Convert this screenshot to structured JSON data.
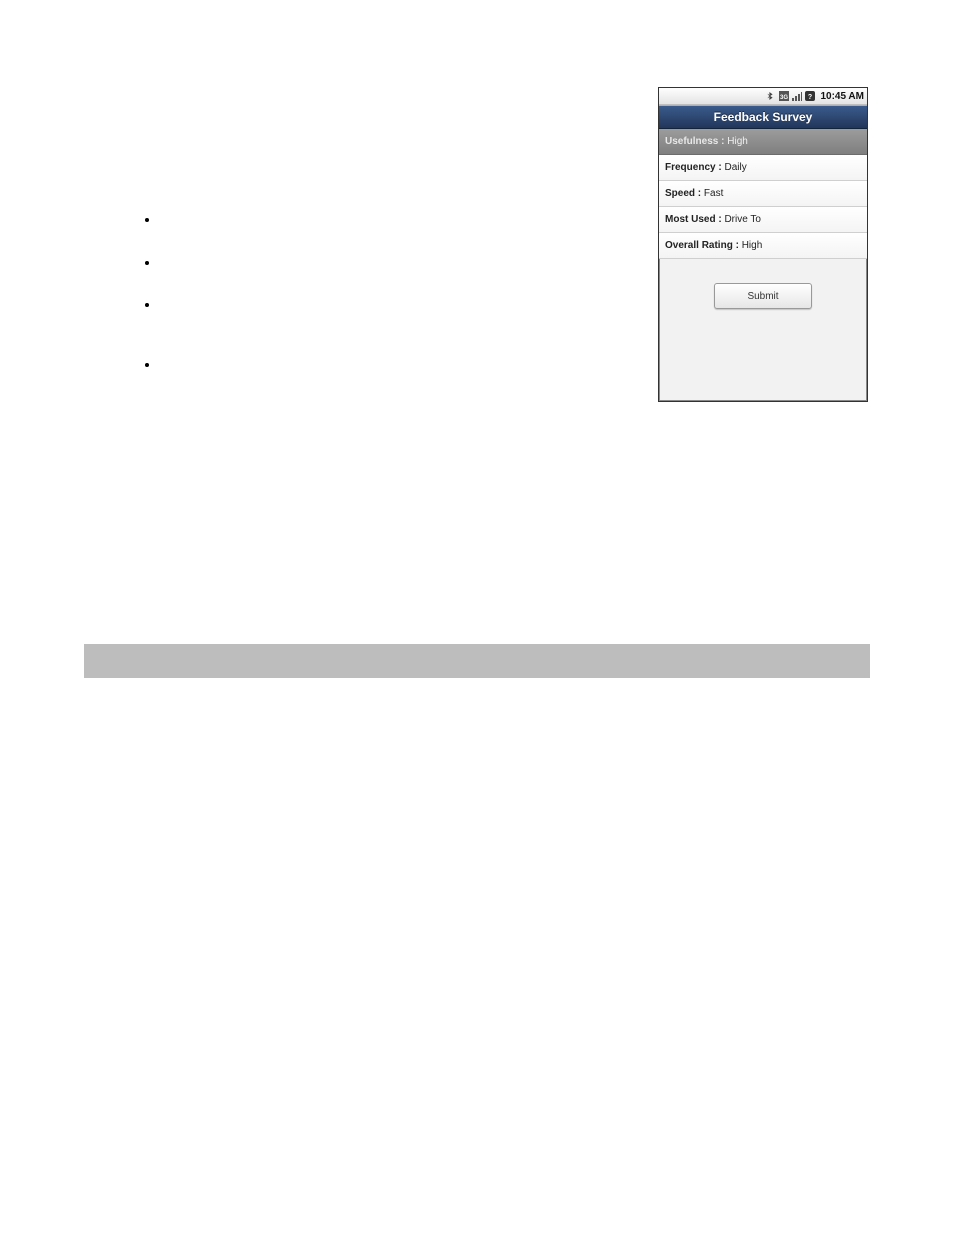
{
  "bullets": [
    "",
    "",
    "",
    ""
  ],
  "statusbar": {
    "time": "10:45 AM"
  },
  "titlebar": {
    "text": "Feedback Survey"
  },
  "rows": [
    {
      "label": "Usefulness : ",
      "value": "High"
    },
    {
      "label": "Frequency : ",
      "value": "Daily"
    },
    {
      "label": "Speed : ",
      "value": "Fast"
    },
    {
      "label": "Most Used : ",
      "value": "Drive To"
    },
    {
      "label": "Overall Rating : ",
      "value": "High"
    }
  ],
  "submit": {
    "label": "Submit"
  }
}
